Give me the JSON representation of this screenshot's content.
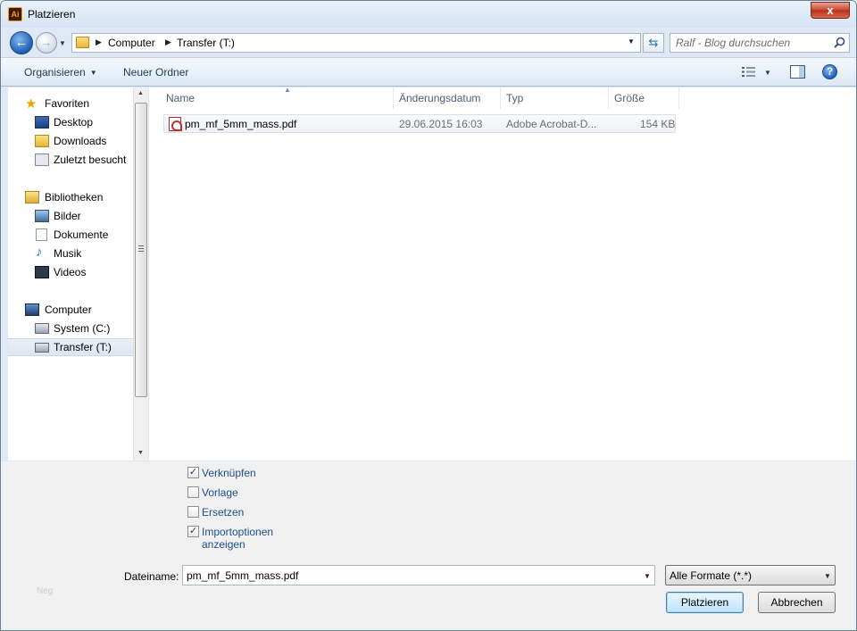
{
  "window": {
    "title": "Platzieren",
    "app_icon": "Ai",
    "close": "x"
  },
  "nav": {
    "breadcrumbs": [
      "Computer",
      "Transfer (T:)"
    ],
    "search_placeholder": "Ralf - Blog durchsuchen"
  },
  "toolbar": {
    "organize": "Organisieren",
    "new_folder": "Neuer Ordner",
    "help": "?"
  },
  "sidebar": {
    "favorites": {
      "label": "Favoriten",
      "items": [
        "Desktop",
        "Downloads",
        "Zuletzt besucht"
      ]
    },
    "libraries": {
      "label": "Bibliotheken",
      "items": [
        "Bilder",
        "Dokumente",
        "Musik",
        "Videos"
      ]
    },
    "computer": {
      "label": "Computer",
      "items": [
        "System (C:)",
        "Transfer (T:)"
      ],
      "selected": "Transfer (T:)"
    }
  },
  "columns": [
    "Name",
    "Änderungsdatum",
    "Typ",
    "Größe"
  ],
  "files": [
    {
      "name": "pm_mf_5mm_mass.pdf",
      "modified": "29.06.2015 16:03",
      "type": "Adobe Acrobat-D...",
      "size": "154 KB"
    }
  ],
  "options": [
    {
      "label": "Verknüpfen",
      "checked": true
    },
    {
      "label": "Vorlage",
      "checked": false
    },
    {
      "label": "Ersetzen",
      "checked": false
    },
    {
      "label": "Importoptionen",
      "label2": "anzeigen",
      "checked": true
    }
  ],
  "filename": {
    "label": "Dateiname:",
    "value": "pm_mf_5mm_mass.pdf"
  },
  "filter": {
    "value": "Alle Formate (*.*)"
  },
  "buttons": {
    "place": "Platzieren",
    "cancel": "Abbrechen"
  },
  "faint_label": "Neg",
  "colors": {
    "accent": "#1f5fb8",
    "link_text": "#1b4f8c",
    "selection": "#dde6f1"
  }
}
